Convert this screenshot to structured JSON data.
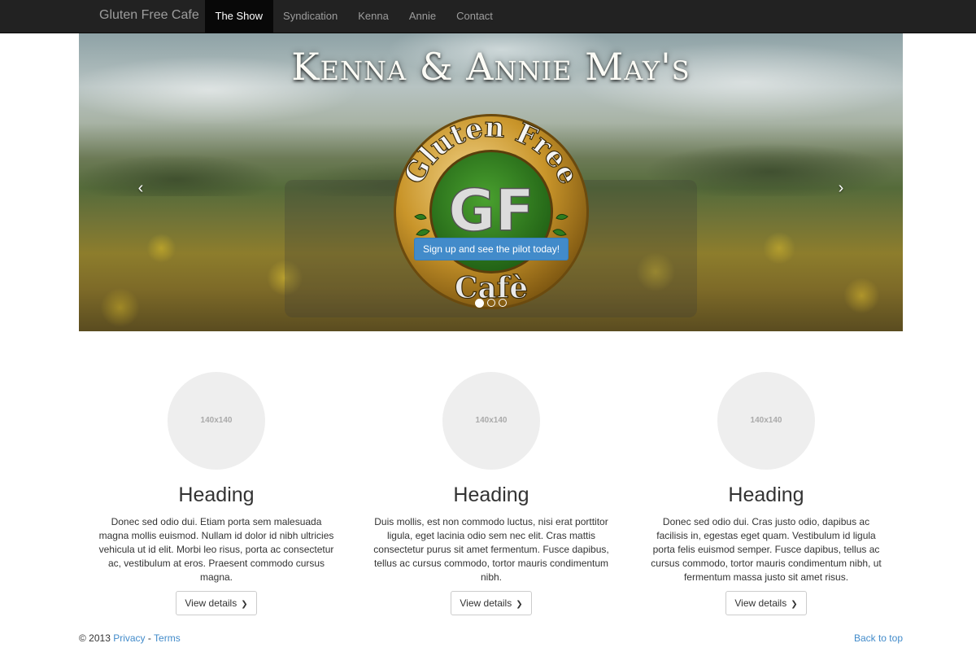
{
  "navbar": {
    "brand": "Gluten Free Cafe",
    "items": [
      {
        "label": "The Show",
        "active": true
      },
      {
        "label": "Syndication",
        "active": false
      },
      {
        "label": "Kenna",
        "active": false
      },
      {
        "label": "Annie",
        "active": false
      },
      {
        "label": "Contact",
        "active": false
      }
    ]
  },
  "carousel": {
    "title": "Kenna & Annie May's",
    "logo": {
      "top_text": "Gluten Free",
      "center_text": "GF",
      "bottom_text": "Cafè",
      "colors": {
        "gold": "#c9952a",
        "green": "#2e7d1f",
        "silver": "#d9d9d9"
      }
    },
    "cta_label": "Sign up and see the pilot today!",
    "prev_icon": "‹",
    "next_icon": "›",
    "indicators": [
      true,
      false,
      false
    ]
  },
  "columns": [
    {
      "thumb_label": "140x140",
      "heading": "Heading",
      "text": "Donec sed odio dui. Etiam porta sem malesuada magna mollis euismod. Nullam id dolor id nibh ultricies vehicula ut id elit. Morbi leo risus, porta ac consectetur ac, vestibulum at eros. Praesent commodo cursus magna.",
      "button_label": "View details"
    },
    {
      "thumb_label": "140x140",
      "heading": "Heading",
      "text": "Duis mollis, est non commodo luctus, nisi erat porttitor ligula, eget lacinia odio sem nec elit. Cras mattis consectetur purus sit amet fermentum. Fusce dapibus, tellus ac cursus commodo, tortor mauris condimentum nibh.",
      "button_label": "View details"
    },
    {
      "thumb_label": "140x140",
      "heading": "Heading",
      "text": "Donec sed odio dui. Cras justo odio, dapibus ac facilisis in, egestas eget quam. Vestibulum id ligula porta felis euismod semper. Fusce dapibus, tellus ac cursus commodo, tortor mauris condimentum nibh, ut fermentum massa justo sit amet risus.",
      "button_label": "View details"
    }
  ],
  "footer": {
    "copyright": "© 2013",
    "privacy": "Privacy",
    "separator": "-",
    "terms": "Terms",
    "back_to_top": "Back to top"
  },
  "colors": {
    "navbar_bg": "#222222",
    "link": "#428bca",
    "primary_button": "#428bca"
  }
}
